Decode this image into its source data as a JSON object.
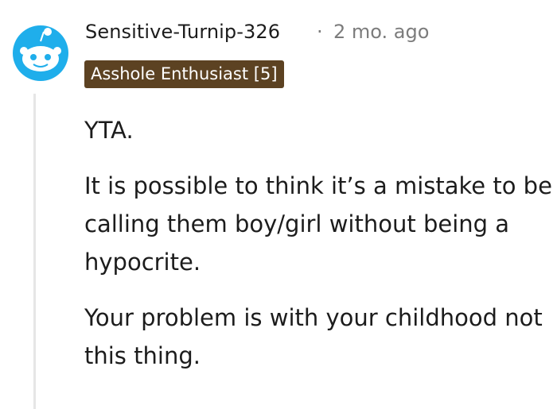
{
  "comment": {
    "author": "Sensitive-Turnip-326",
    "separator": "·",
    "time_ago": "2 mo. ago",
    "flair": "Asshole Enthusiast [5]",
    "paragraphs": [
      "YTA.",
      "It is possible to think it’s a mistake to be calling them boy/girl without being a hypocrite.",
      "Your problem is with your childhood not this thing."
    ]
  },
  "colors": {
    "flair_background": "#5c4222",
    "avatar_blue": "#1faeeb",
    "text": "#1c1c1c",
    "meta": "#7c7c7c"
  },
  "icons": {
    "avatar": "snoo-avatar-icon"
  }
}
